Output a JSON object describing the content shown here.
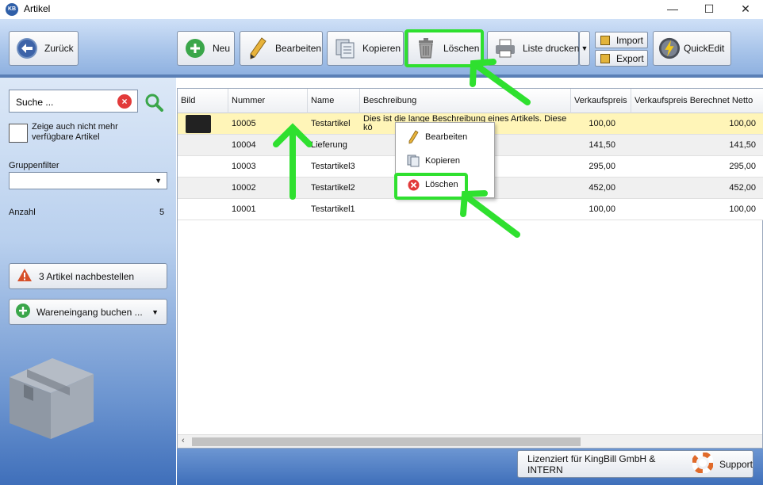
{
  "window": {
    "title": "Artikel",
    "app_badge": "KB",
    "minimize": "—",
    "maximize": "☐",
    "close": "✕"
  },
  "toolbar": {
    "back": "Zurück",
    "new": "Neu",
    "edit": "Bearbeiten",
    "copy": "Kopieren",
    "delete": "Löschen",
    "print_list": "Liste drucken",
    "import": "Import",
    "export": "Export",
    "quickedit": "QuickEdit"
  },
  "sidebar": {
    "search_value": "Suche ...",
    "show_unavailable_label": "Zeige auch nicht mehr verfügbare Artikel",
    "group_filter_label": "Gruppenfilter",
    "group_filter_value": "",
    "count_label": "Anzahl",
    "count_value": "5",
    "reorder_button": "3 Artikel nachbestellen",
    "goods_receipt_button": "Wareneingang buchen ..."
  },
  "grid": {
    "columns": [
      "Bild",
      "Nummer",
      "Name",
      "Beschreibung",
      "Verkaufspreis",
      "Verkaufspreis Berechnet Netto"
    ],
    "rows": [
      {
        "number": "10005",
        "name": "Testartikel",
        "description": "Dies ist die lange Beschreibung eines Artikels. Diese kö",
        "price": "100,00",
        "net_price": "100,00",
        "selected": true,
        "has_image": true
      },
      {
        "number": "10004",
        "name": "Lieferung",
        "description": "",
        "price": "141,50",
        "net_price": "141,50",
        "selected": false,
        "has_image": false
      },
      {
        "number": "10003",
        "name": "Testartikel3",
        "description": "",
        "price": "295,00",
        "net_price": "295,00",
        "selected": false,
        "has_image": false
      },
      {
        "number": "10002",
        "name": "Testartikel2",
        "description": "",
        "price": "452,00",
        "net_price": "452,00",
        "selected": false,
        "has_image": false
      },
      {
        "number": "10001",
        "name": "Testartikel1",
        "description": "",
        "price": "100,00",
        "net_price": "100,00",
        "selected": false,
        "has_image": false
      }
    ]
  },
  "context_menu": {
    "items": [
      "Bearbeiten",
      "Kopieren",
      "Löschen"
    ]
  },
  "footer": {
    "license": "Lizenziert für KingBill GmbH & INTERN",
    "support": "Support"
  },
  "colors": {
    "highlight": "#2fe02f",
    "selected_row": "#fff5b8",
    "accent_blue": "#3f6fba",
    "delete_red": "#e23a3a"
  }
}
